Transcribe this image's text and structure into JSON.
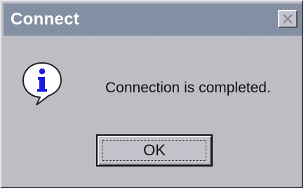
{
  "dialog": {
    "title": "Connect",
    "message": "Connection is completed.",
    "icon": "info-icon",
    "ok_label": "OK"
  },
  "colors": {
    "titlebar": "#838fa3",
    "face": "#bdbdc4",
    "icon_blue": "#1a1ae0"
  }
}
